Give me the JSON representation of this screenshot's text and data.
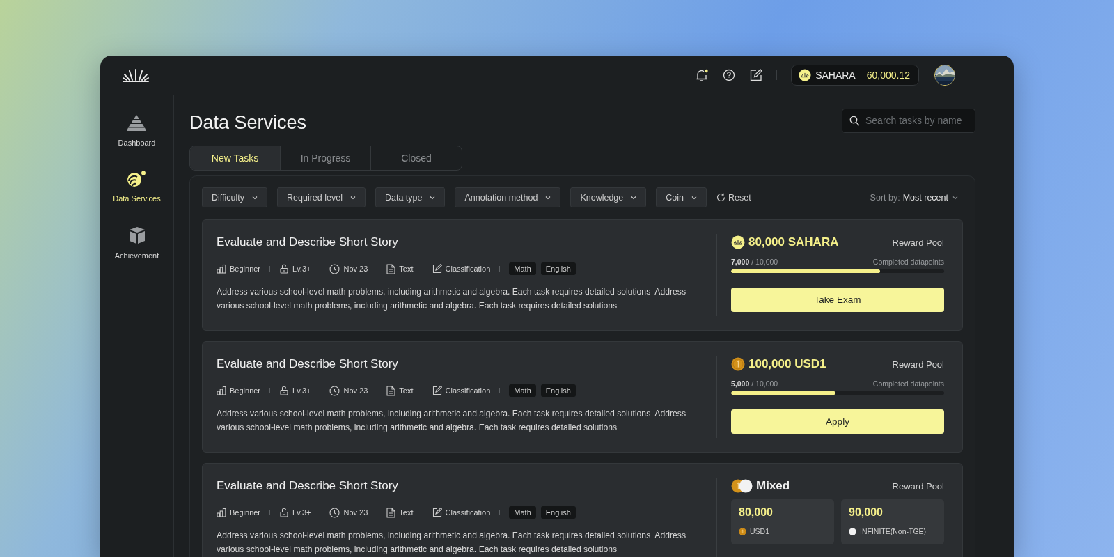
{
  "header": {
    "balance": {
      "currency": "SAHARA",
      "amount": "60,000.12"
    }
  },
  "sidebar": {
    "items": [
      {
        "kind": "dashboard",
        "label": "Dashboard",
        "selected": false
      },
      {
        "kind": "services",
        "label": "Data Services",
        "selected": true
      },
      {
        "kind": "achievement",
        "label": "Achievement",
        "selected": false
      }
    ]
  },
  "page": {
    "title": "Data Services",
    "search": {
      "placeholder": "Search tasks by name"
    },
    "tabs": [
      {
        "label": "New Tasks",
        "selected": true
      },
      {
        "label": "In Progress",
        "selected": false
      },
      {
        "label": "Closed",
        "selected": false
      }
    ],
    "filters": [
      "Difficulty",
      "Required level",
      "Data type",
      "Annotation method",
      "Knowledge",
      "Coin"
    ],
    "reset": "Reset",
    "sort": {
      "label": "Sort by:",
      "value": "Most recent"
    }
  },
  "tasks": [
    {
      "title": "Evaluate and Describe Short Story",
      "meta": [
        "Beginner",
        "Lv.3+",
        "Nov 23",
        "Text",
        "Classification"
      ],
      "tags": [
        "Math",
        "English"
      ],
      "description": "Address various school-level math problems, including arithmetic and algebra. Each task requires detailed solutions  Address various school-level math problems, including arithmetic and algebra. Each task requires detailed solutions",
      "reward": {
        "kind": "sahara",
        "amount": "80,000 SAHARA",
        "label": "Reward Pool"
      },
      "progress": {
        "done": "7,000",
        "total": "/ 10,000",
        "label": "Completed datapoints",
        "level": 0.7
      },
      "action": "Take Exam"
    },
    {
      "title": "Evaluate and Describe Short Story",
      "meta": [
        "Beginner",
        "Lv.3+",
        "Nov 23",
        "Text",
        "Classification"
      ],
      "tags": [
        "Math",
        "English"
      ],
      "description": "Address various school-level math problems, including arithmetic and algebra. Each task requires detailed solutions  Address various school-level math problems, including arithmetic and algebra. Each task requires detailed solutions",
      "reward": {
        "kind": "usd1",
        "amount": "100,000 USD1",
        "label": "Reward Pool"
      },
      "progress": {
        "done": "5,000",
        "total": "/ 10,000",
        "label": "Completed datapoints",
        "level": 0.49
      },
      "action": "Apply"
    },
    {
      "title": "Evaluate and Describe Short Story",
      "meta": [
        "Beginner",
        "Lv.3+",
        "Nov 23",
        "Text",
        "Classification"
      ],
      "tags": [
        "Math",
        "English"
      ],
      "description": "Address various school-level math problems, including arithmetic and algebra. Each task requires detailed solutions  Address various school-level math problems, including arithmetic and algebra. Each task requires detailed solutions",
      "reward": {
        "kind": "mixed",
        "amount": "Mixed",
        "label": "Reward Pool",
        "pools": [
          {
            "amount": "80,000",
            "kind": "usd1",
            "name": "USD1"
          },
          {
            "amount": "90,000",
            "kind": "infinite",
            "name": "INFINITE(Non-TGE)"
          }
        ]
      }
    }
  ]
}
